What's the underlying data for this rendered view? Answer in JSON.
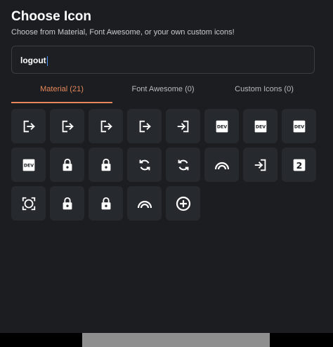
{
  "dialog": {
    "title": "Choose Icon",
    "subtitle": "Choose from Material, Font Awesome, or your own custom icons!"
  },
  "search": {
    "value": "logout"
  },
  "tabs": [
    {
      "label": "Material (21)",
      "active": true
    },
    {
      "label": "Font Awesome (0)",
      "active": false
    },
    {
      "label": "Custom Icons (0)",
      "active": false
    }
  ],
  "icons": [
    {
      "name": "logout-icon"
    },
    {
      "name": "logout-icon"
    },
    {
      "name": "logout-icon"
    },
    {
      "name": "logout-icon"
    },
    {
      "name": "login-icon"
    },
    {
      "name": "dev-icon",
      "label": "DEV"
    },
    {
      "name": "dev-icon",
      "label": "DEV"
    },
    {
      "name": "dev-icon",
      "label": "DEV"
    },
    {
      "name": "dev-icon",
      "label": "DEV"
    },
    {
      "name": "lock-icon"
    },
    {
      "name": "lock-icon"
    },
    {
      "name": "sync-icon"
    },
    {
      "name": "sync-icon"
    },
    {
      "name": "arc-icon"
    },
    {
      "name": "login-icon"
    },
    {
      "name": "looks-two-icon",
      "label": "2"
    },
    {
      "name": "center-focus-icon"
    },
    {
      "name": "lock-icon"
    },
    {
      "name": "lock-icon"
    },
    {
      "name": "arc-icon"
    },
    {
      "name": "add-circle-icon"
    }
  ],
  "colors": {
    "background": "#1b1d21",
    "tile": "#26292e",
    "accent": "#e6875a",
    "border": "#3a3d43"
  }
}
